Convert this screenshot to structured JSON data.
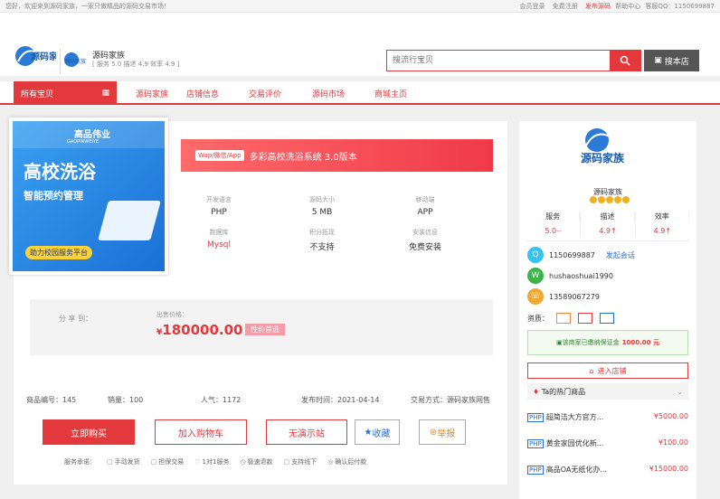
{
  "topbar": {
    "welcome": "您好，欢迎来到源码家族，一家只做精品的源码交易市场！",
    "login": "会员登录",
    "register": "免费注册",
    "publish": "发布源码",
    "help": "帮助中心",
    "qq": "客服QQ：1150699887"
  },
  "header": {
    "shop_name": "源码家族",
    "shop_stats": "[ 服务 5.0  描述 4.9  效率 4.9 ]",
    "search_placeholder": "搜流行宝贝",
    "shop_search_label": "搜本店"
  },
  "nav": {
    "all": "所有宝贝",
    "items": [
      "源码家族",
      "店铺信息",
      "交易评价",
      "源码市场",
      "商城主页"
    ]
  },
  "product": {
    "tag": "Wap/微信/App",
    "title": "多彩高校洗浴系统 3.0版本",
    "cover": {
      "brand": "高品伟业",
      "brand_en": "GAOPINWEIYE",
      "headline": "高校洗浴",
      "sub": "智能预约管理",
      "badge": "助力校园服务平台"
    },
    "specs": [
      {
        "label": "开发语言",
        "value": "PHP"
      },
      {
        "label": "源码大小",
        "value": "5 MB"
      },
      {
        "label": "移动端",
        "value": "APP"
      },
      {
        "label": "数据库",
        "value": "Mysql"
      },
      {
        "label": "积分抵现",
        "value": "不支持"
      },
      {
        "label": "安装信息",
        "value": "免费安装"
      }
    ],
    "share_label": "分 享 到：",
    "price_label": "出售价格：",
    "price_symbol": "¥",
    "price": "180000.00",
    "price_tag": "性价首选",
    "info": {
      "code": "商品编号：145",
      "sales": "销量：100",
      "popularity": "人气：1172",
      "publish": "发布时间：2021-04-14",
      "trade": "交易方式：源码家族网售"
    },
    "buttons": {
      "buy": "立即购买",
      "cart": "加入购物车",
      "demo": "无演示站",
      "fav": "收藏",
      "report": "举报"
    },
    "promise_label": "服务承诺：",
    "promises": [
      "手动发货",
      "担保交易",
      "1对1服务",
      "极速退款",
      "支持线下",
      "确认后付款"
    ]
  },
  "side": {
    "shop_name": "源码家族",
    "scores": [
      {
        "label": "服务",
        "value": "5.0--"
      },
      {
        "label": "描述",
        "value": "4.9↑"
      },
      {
        "label": "效率",
        "value": "4.9↑"
      }
    ],
    "qq": "1150699887",
    "qq_link": "发起会话",
    "wechat": "hushaoshuai1990",
    "phone": "13589067279",
    "quals_label": "资质：",
    "deposit": "该商家已缴纳保证金",
    "deposit_amount": "1000.00 元",
    "enter": "进入店铺",
    "hot_title": "Ta的热门商品",
    "hot_items": [
      {
        "tag": "PHP",
        "name": "超简洁大方官方...",
        "price": "¥5000.00"
      },
      {
        "tag": "PHP",
        "name": "黄金家园优化新...",
        "price": "¥100.00"
      },
      {
        "tag": "PHP",
        "name": "高品OA无纸化办...",
        "price": "¥15000.00"
      }
    ]
  },
  "colors": {
    "accent": "#e4393c"
  }
}
